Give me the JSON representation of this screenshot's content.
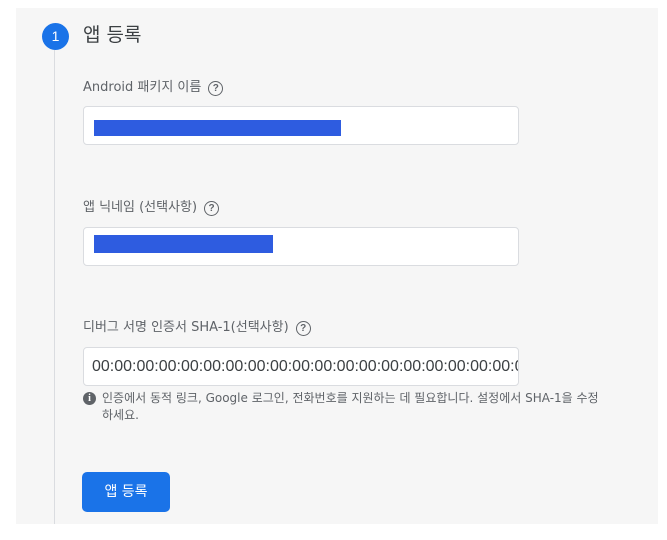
{
  "step": {
    "number": "1",
    "title": "앱 등록"
  },
  "fields": {
    "package_name": {
      "label": "Android 패키지 이름",
      "value": ""
    },
    "nickname": {
      "label": "앱 닉네임 (선택사항)",
      "value": ""
    },
    "sha1": {
      "label": "디버그 서명 인증서 SHA-1(선택사항)",
      "value": "00:00:00:00:00:00:00:00:00:00:00:00:00:00:00:00:00:00:00:00"
    }
  },
  "hint": {
    "text": "인증에서 동적 링크, Google 로그인, 전화번호를 지원하는 데 필요합니다. 설정에서 SHA-1을 수정하세요."
  },
  "submit_button": {
    "label": "앱 등록"
  },
  "icons": {
    "help": "help-circle-icon",
    "info": "info-icon"
  },
  "colors": {
    "accent": "#1a73e8",
    "redaction": "#2e5ce0"
  }
}
